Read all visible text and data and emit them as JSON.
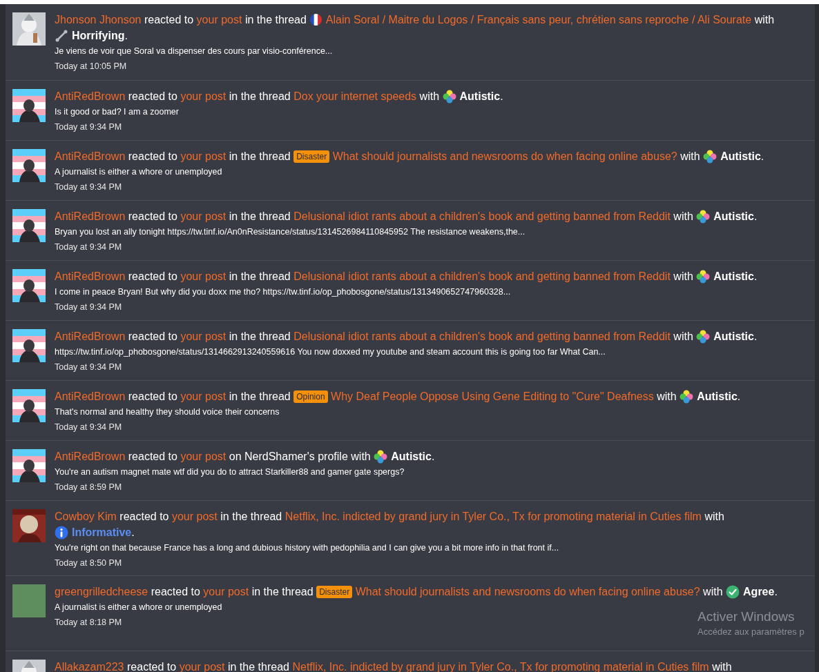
{
  "alerts": [
    {
      "user": "Jhonson Jhonson",
      "verb": "reacted to",
      "target": "your post",
      "location": "in the thread",
      "prefix": {
        "kind": "flag"
      },
      "thread": "Alain Soral / Maitre du Logos / Français sans peur, chrétien sans reproche / Ali Sourate",
      "with": "with",
      "reaction": {
        "kind": "horrifying",
        "label": "Horrifying",
        "punct": "."
      },
      "snippet": "Je viens de voir que Soral va dispenser des cours par visio-conférence...",
      "time": "Today at 10:05 PM"
    },
    {
      "user": "AntiRedBrown",
      "verb": "reacted to",
      "target": "your post",
      "location": "in the thread",
      "thread": "Dox your internet speeds",
      "with": "with",
      "reaction": {
        "kind": "autistic",
        "label": "Autistic",
        "punct": "."
      },
      "snippet": "Is it good or bad? I am a zoomer",
      "time": "Today at 9:34 PM"
    },
    {
      "user": "AntiRedBrown",
      "verb": "reacted to",
      "target": "your post",
      "location": "in the thread",
      "prefix": {
        "kind": "label",
        "text": "Disaster"
      },
      "thread": "What should journalists and newsrooms do when facing online abuse?",
      "with": "with",
      "reaction": {
        "kind": "autistic",
        "label": "Autistic",
        "punct": "."
      },
      "snippet": "A journalist is either a whore or unemployed",
      "time": "Today at 9:34 PM"
    },
    {
      "user": "AntiRedBrown",
      "verb": "reacted to",
      "target": "your post",
      "location": "in the thread",
      "thread": "Delusional idiot rants about a children's book and getting banned from Reddit",
      "with": "with",
      "reaction": {
        "kind": "autistic",
        "label": "Autistic",
        "punct": "."
      },
      "snippet": "Bryan you lost an ally tonight https://tw.tinf.io/An0nResistance/status/1314526984110845952 The resistance weakens,the...",
      "time": "Today at 9:34 PM"
    },
    {
      "user": "AntiRedBrown",
      "verb": "reacted to",
      "target": "your post",
      "location": "in the thread",
      "thread": "Delusional idiot rants about a children's book and getting banned from Reddit",
      "with": "with",
      "reaction": {
        "kind": "autistic",
        "label": "Autistic",
        "punct": "."
      },
      "snippet": "I come in peace Bryan! But why did you doxx me tho? https://tw.tinf.io/op_phobosgone/status/1313490652747960328...",
      "time": "Today at 9:34 PM"
    },
    {
      "user": "AntiRedBrown",
      "verb": "reacted to",
      "target": "your post",
      "location": "in the thread",
      "thread": "Delusional idiot rants about a children's book and getting banned from Reddit",
      "with": "with",
      "reaction": {
        "kind": "autistic",
        "label": "Autistic",
        "punct": "."
      },
      "snippet": "https://tw.tinf.io/op_phobosgone/status/1314662913240559616 You now doxxed my youtube and steam account this is going too far What Can...",
      "time": "Today at 9:34 PM"
    },
    {
      "user": "AntiRedBrown",
      "verb": "reacted to",
      "target": "your post",
      "location": "in the thread",
      "prefix": {
        "kind": "label",
        "text": "Opinion"
      },
      "thread": "Why Deaf People Oppose Using Gene Editing to \"Cure\" Deafness",
      "with": "with",
      "reaction": {
        "kind": "autistic",
        "label": "Autistic",
        "punct": "."
      },
      "snippet": "That's normal and healthy they should voice their concerns",
      "time": "Today at 9:34 PM"
    },
    {
      "user": "AntiRedBrown",
      "verb": "reacted to",
      "target": "your post",
      "location": "on NerdShamer's profile",
      "with": "with",
      "reaction": {
        "kind": "autistic",
        "label": "Autistic",
        "punct": "."
      },
      "snippet": "You're an autism magnet mate wtf did you do to attract Starkiller88 and gamer gate spergs?",
      "time": "Today at 8:59 PM"
    },
    {
      "user": "Cowboy Kim",
      "verb": "reacted to",
      "target": "your post",
      "location": "in the thread",
      "thread": "Netflix, Inc. indicted by grand jury in Tyler Co., Tx for promoting material in Cuties film",
      "with": "with",
      "reaction": {
        "kind": "informative",
        "label": "Informative",
        "punct": "."
      },
      "snippet": "You're right on that because France has a long and dubious history with pedophilia and I can give you a bit more info in that front if...",
      "time": "Today at 8:50 PM"
    },
    {
      "user": "greengrilledcheese",
      "avatar": {
        "kind": "plain",
        "color": "#5e8d5e"
      },
      "verb": "reacted to",
      "target": "your post",
      "location": "in the thread",
      "prefix": {
        "kind": "label",
        "text": "Disaster"
      },
      "thread": "What should journalists and newsrooms do when facing online abuse?",
      "with": "with",
      "reaction": {
        "kind": "agree",
        "label": "Agree",
        "punct": "."
      },
      "snippet": "A journalist is either a whore or unemployed",
      "time": "Today at 8:18 PM"
    },
    {
      "user": "Allakazam223",
      "verb": "reacted to",
      "target": "your post",
      "location": "in the thread",
      "thread": "Netflix, Inc. indicted by grand jury in Tyler Co., Tx for promoting material in Cuties film",
      "with": "with"
    }
  ],
  "os_notice": {
    "title": "Activer Windows",
    "subtitle": "Accédez aux paramètres p"
  }
}
